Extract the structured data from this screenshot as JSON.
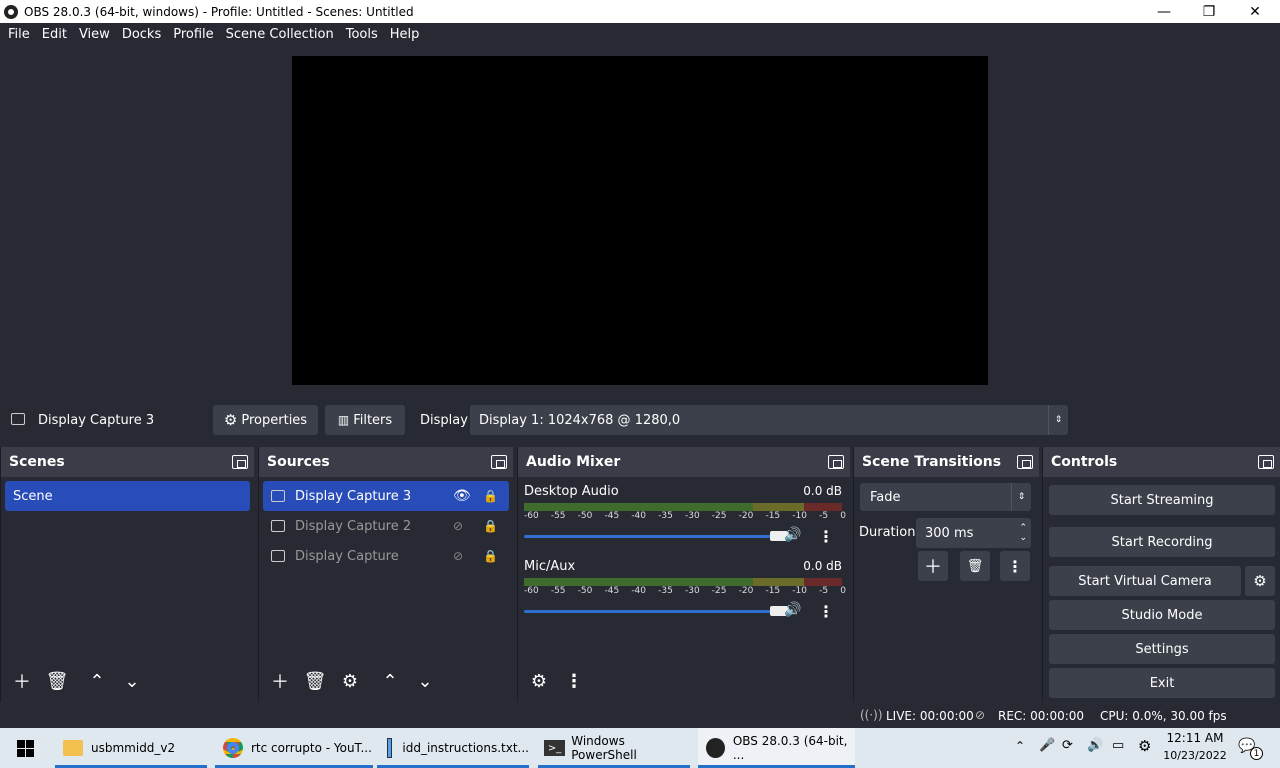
{
  "window": {
    "title": "OBS 28.0.3 (64-bit, windows) - Profile: Untitled - Scenes: Untitled",
    "minimize": "—",
    "maximize": "❐",
    "close": "✕"
  },
  "menu": [
    "File",
    "Edit",
    "View",
    "Docks",
    "Profile",
    "Scene Collection",
    "Tools",
    "Help"
  ],
  "context": {
    "source": "Display Capture 3",
    "properties": "Properties",
    "filters": "Filters",
    "display_label": "Display",
    "display_value": "Display 1: 1024x768 @ 1280,0"
  },
  "scenes": {
    "title": "Scenes",
    "items": [
      "Scene"
    ]
  },
  "sources": {
    "title": "Sources",
    "items": [
      "Display Capture 3",
      "Display Capture 2",
      "Display Capture"
    ]
  },
  "mixer": {
    "title": "Audio Mixer",
    "ticks": [
      "-60",
      "-55",
      "-50",
      "-45",
      "-40",
      "-35",
      "-30",
      "-25",
      "-20",
      "-15",
      "-10",
      "-5",
      "0"
    ],
    "channels": [
      {
        "name": "Desktop Audio",
        "db": "0.0 dB",
        "volume": 1.0
      },
      {
        "name": "Mic/Aux",
        "db": "0.0 dB",
        "volume": 1.0
      }
    ]
  },
  "transitions": {
    "title": "Scene Transitions",
    "type": "Fade",
    "duration_label": "Duration",
    "duration_value": "300 ms"
  },
  "controls": {
    "title": "Controls",
    "buttons": [
      "Start Streaming",
      "Start Recording",
      "Start Virtual Camera",
      "Studio Mode",
      "Settings",
      "Exit"
    ]
  },
  "status": {
    "live": "LIVE: 00:00:00",
    "rec": "REC: 00:00:00",
    "cpu": "CPU: 0.0%, 30.00 fps"
  },
  "taskbar": {
    "items": [
      "usbmmidd_v2",
      "rtc corrupto - YouT...",
      "idd_instructions.txt...",
      "Windows PowerShell",
      "OBS 28.0.3 (64-bit, ..."
    ],
    "time": "12:11 AM",
    "date": "10/23/2022",
    "notif": "1"
  }
}
